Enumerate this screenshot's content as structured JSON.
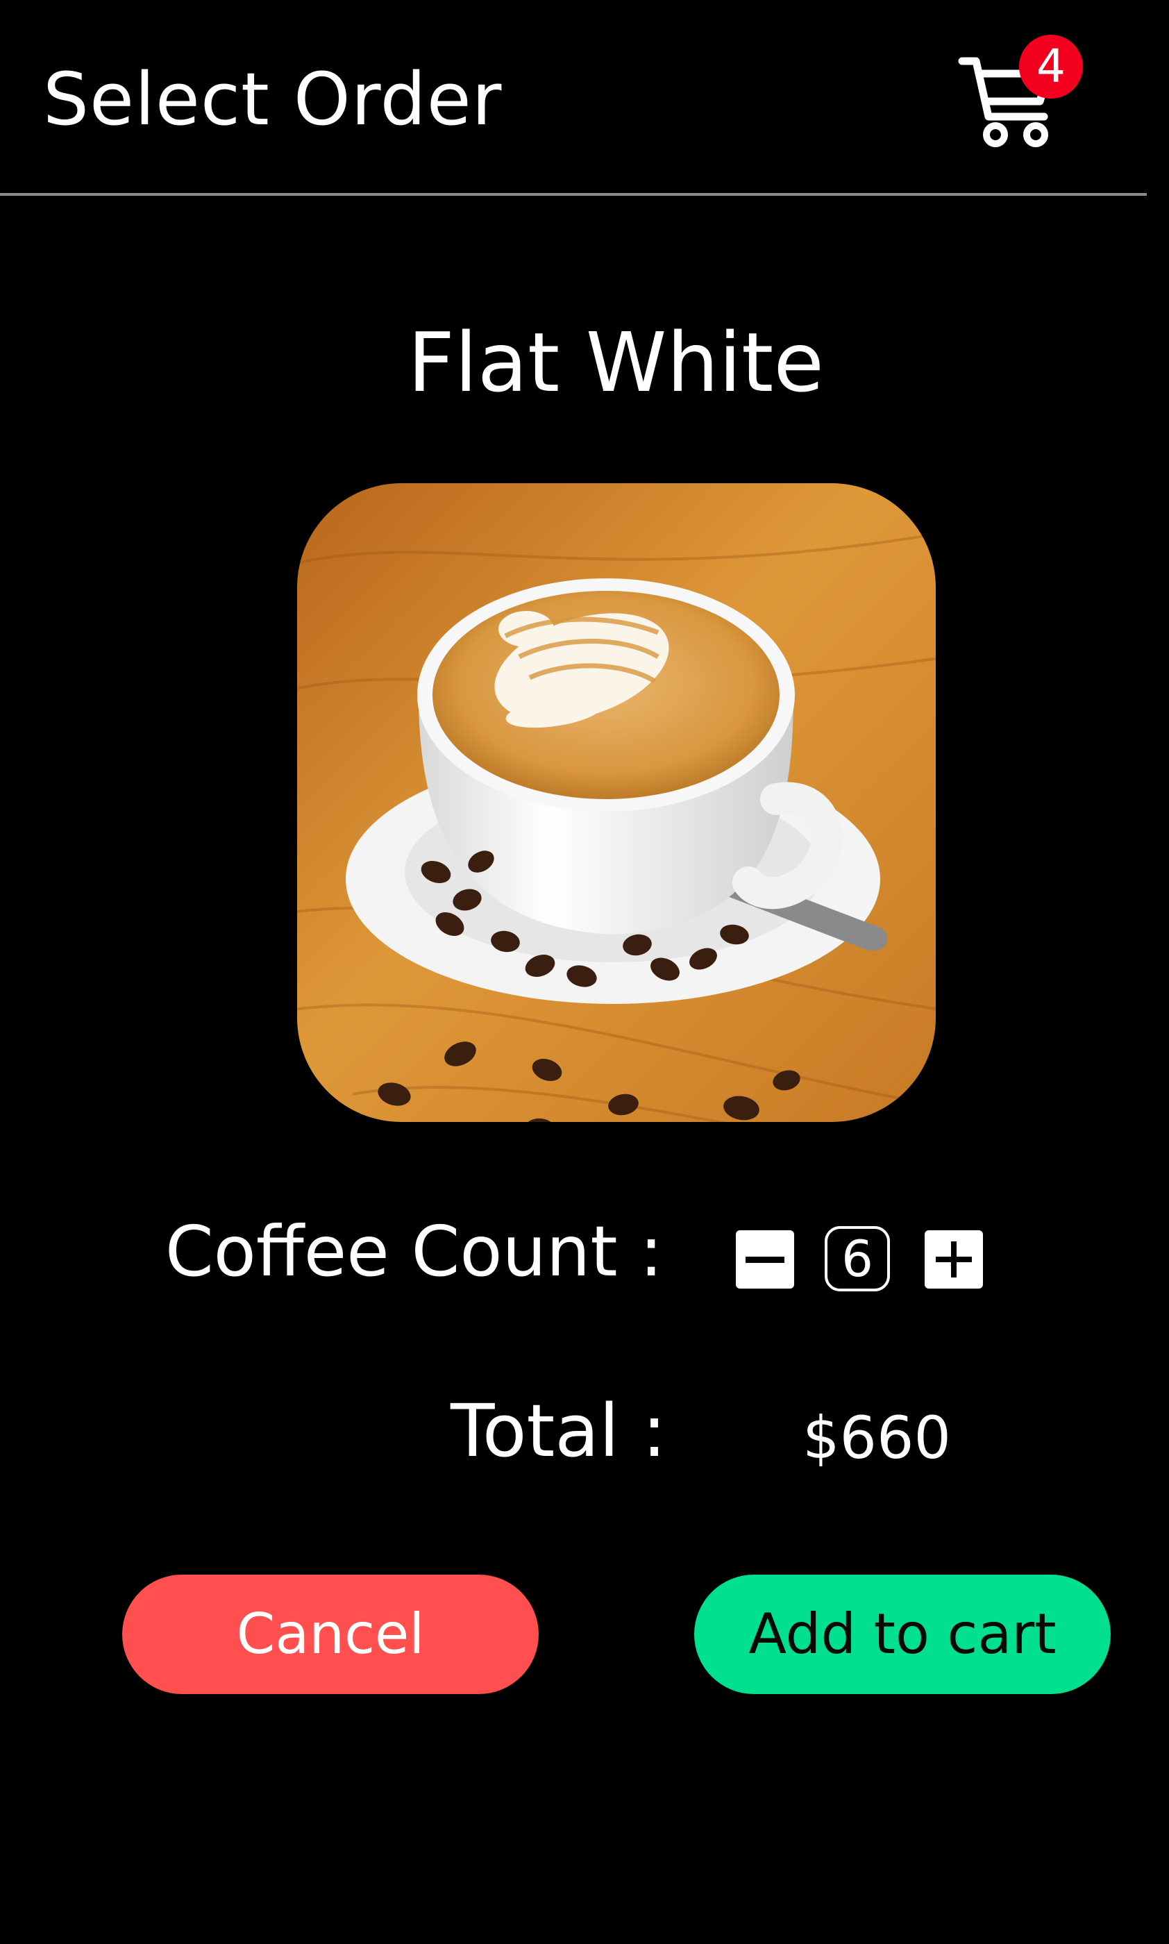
{
  "header": {
    "title": "Select Order",
    "cart": {
      "icon": "shopping-cart-icon",
      "badge_count": "4",
      "badge_color": "#f2001e"
    }
  },
  "product": {
    "name": "Flat White",
    "image": "latte-art-coffee-cup-on-saucer-with-beans"
  },
  "quantity": {
    "label": "Coffee Count :",
    "value": "6",
    "decrement_icon": "minus-icon",
    "increment_icon": "plus-icon"
  },
  "total": {
    "label": "Total :",
    "value": "$660"
  },
  "actions": {
    "cancel_label": "Cancel",
    "cancel_color": "#ff4f4f",
    "add_label": "Add to cart",
    "add_color": "#00e08e"
  }
}
